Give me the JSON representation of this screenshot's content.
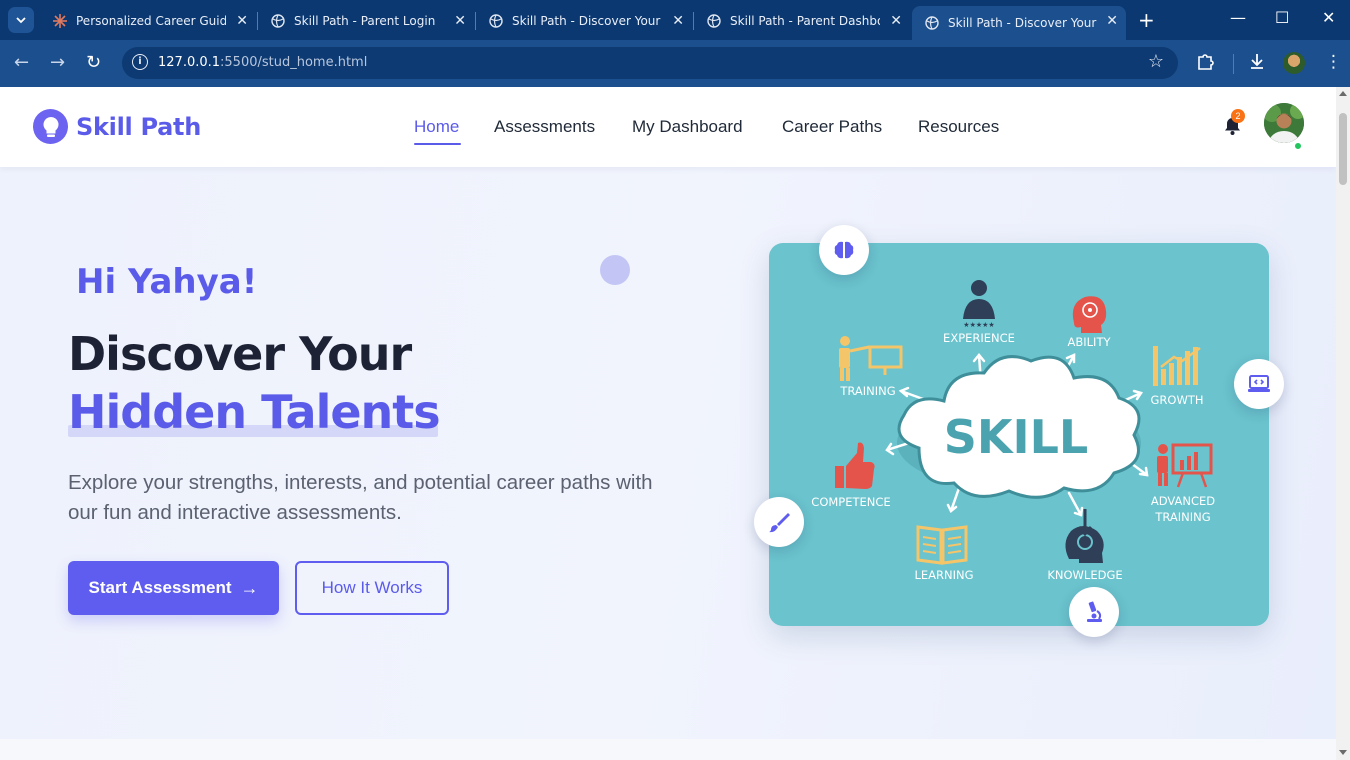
{
  "browser": {
    "tabs": [
      {
        "title": "Personalized Career Guidanc",
        "favicon": "sparkle-icon",
        "active": false
      },
      {
        "title": "Skill Path - Parent Login",
        "favicon": "globe-icon",
        "active": false
      },
      {
        "title": "Skill Path - Discover Your Fu",
        "favicon": "globe-icon",
        "active": false
      },
      {
        "title": "Skill Path - Parent Dashboar",
        "favicon": "globe-icon",
        "active": false
      },
      {
        "title": "Skill Path - Discover Your Fu",
        "favicon": "globe-icon",
        "active": true
      }
    ],
    "url_host": "127.0.0.1",
    "url_rest": ":5500/stud_home.html",
    "colors": {
      "tabbar": "#0b3870",
      "toolbar": "#1c4f8d"
    }
  },
  "header": {
    "logo_text": "Skill Path",
    "nav": [
      {
        "label": "Home",
        "active": true
      },
      {
        "label": "Assessments",
        "active": false
      },
      {
        "label": "My Dashboard",
        "active": false
      },
      {
        "label": "Career Paths",
        "active": false
      },
      {
        "label": "Resources",
        "active": false
      }
    ],
    "notification_count": "2"
  },
  "hero": {
    "greeting": "Hi Yahya!",
    "headline_line1": "Discover Your",
    "headline_line2": "Hidden Talents",
    "subtitle": "Explore your strengths, interests, and potential career paths with our fun and interactive assessments.",
    "primary_button": "Start Assessment",
    "secondary_button": "How It Works"
  },
  "illustration": {
    "center_word": "SKILL",
    "labels": {
      "experience": "EXPERIENCE",
      "ability": "ABILITY",
      "training": "TRAINING",
      "growth": "GROWTH",
      "competence": "COMPETENCE",
      "advanced_1": "ADVANCED",
      "advanced_2": "TRAINING",
      "learning": "LEARNING",
      "knowledge": "KNOWLEDGE"
    },
    "float_icons": [
      "brain-icon",
      "code-icon",
      "paintbrush-icon",
      "microscope-icon"
    ]
  },
  "colors": {
    "brand": "#5b5bea",
    "accent_primary": "#5f5cf0",
    "card": "#6ac3cd",
    "badge": "#f97316",
    "online": "#22c55e"
  }
}
